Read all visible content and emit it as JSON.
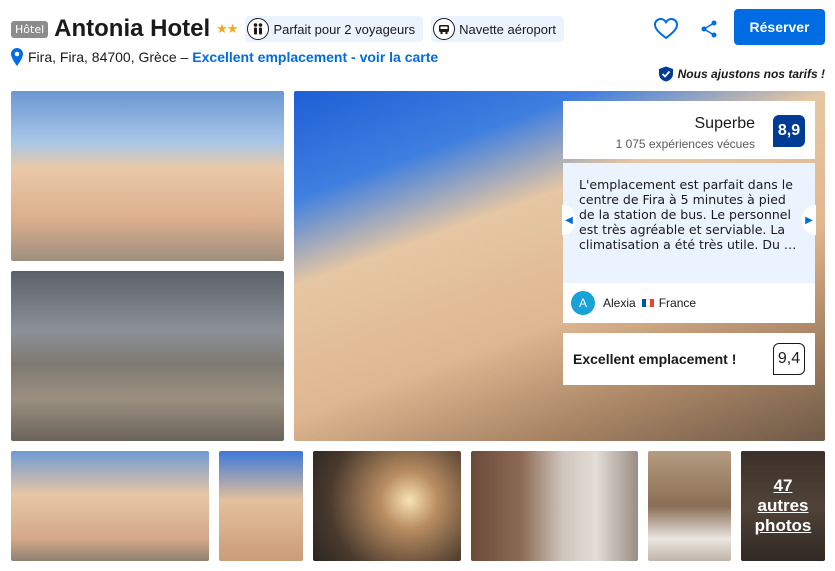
{
  "header": {
    "type_badge": "Hôtel",
    "hotel_name": "Antonia Hotel",
    "stars": "★★",
    "chips": [
      {
        "icon": "people-icon",
        "label": "Parfait pour 2 voyageurs"
      },
      {
        "icon": "shuttle-icon",
        "label": "Navette aéroport"
      }
    ],
    "reserve_label": "Réserver"
  },
  "address": {
    "text": "Fira, Fira, 84700, Grèce –",
    "link": "Excellent emplacement - voir la carte"
  },
  "price_note": "Nous ajustons nos tarifs !",
  "review": {
    "word": "Superbe",
    "count": "1 075 expériences vécues",
    "score": "8,9",
    "text": "L'emplacement est parfait dans le centre de Fira à 5 minutes à pied de la station de bus. Le personnel est très agréable et serviable. La climatisation a été très utile. Du …",
    "author_initial": "A",
    "author_name": "Alexia",
    "author_country": "France"
  },
  "location": {
    "label": "Excellent emplacement !",
    "score": "9,4"
  },
  "gallery": {
    "more_photos": "47\nautres\nphotos"
  },
  "colors": {
    "brand_blue": "#006ce4",
    "score_blue": "#003b95",
    "stars": "#f5a623",
    "chip_bg": "#ebf3ff"
  }
}
